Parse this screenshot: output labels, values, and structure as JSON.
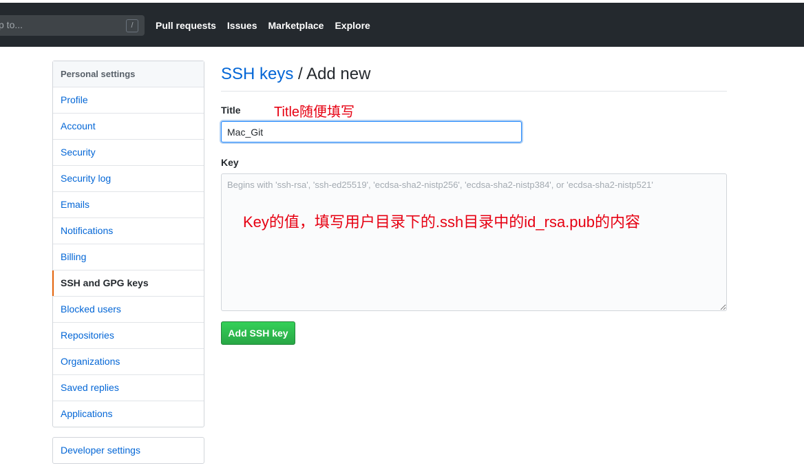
{
  "header": {
    "search_text": "p to...",
    "slash_key": "/",
    "nav": [
      "Pull requests",
      "Issues",
      "Marketplace",
      "Explore"
    ]
  },
  "sidebar": {
    "heading": "Personal settings",
    "items": [
      {
        "label": "Profile"
      },
      {
        "label": "Account"
      },
      {
        "label": "Security"
      },
      {
        "label": "Security log"
      },
      {
        "label": "Emails"
      },
      {
        "label": "Notifications"
      },
      {
        "label": "Billing"
      },
      {
        "label": "SSH and GPG keys",
        "selected": true
      },
      {
        "label": "Blocked users"
      },
      {
        "label": "Repositories"
      },
      {
        "label": "Organizations"
      },
      {
        "label": "Saved replies"
      },
      {
        "label": "Applications"
      }
    ],
    "developer_settings": "Developer settings"
  },
  "main": {
    "breadcrumb": "SSH keys",
    "separator": " / ",
    "title": "Add new",
    "title_label": "Title",
    "title_value": "Mac_Git",
    "key_label": "Key",
    "key_placeholder": "Begins with 'ssh-rsa', 'ssh-ed25519', 'ecdsa-sha2-nistp256', 'ecdsa-sha2-nistp384', or 'ecdsa-sha2-nistp521'",
    "submit_label": "Add SSH key"
  },
  "annotations": {
    "title_note": "Title随便填写",
    "key_note": "Key的值，填写用户目录下的.ssh目录中的id_rsa.pub的内容"
  },
  "colors": {
    "header_bg": "#24292e",
    "link": "#0366d6",
    "selected_marker": "#e36209",
    "annotation": "#e60012",
    "button_green": "#28a745"
  }
}
